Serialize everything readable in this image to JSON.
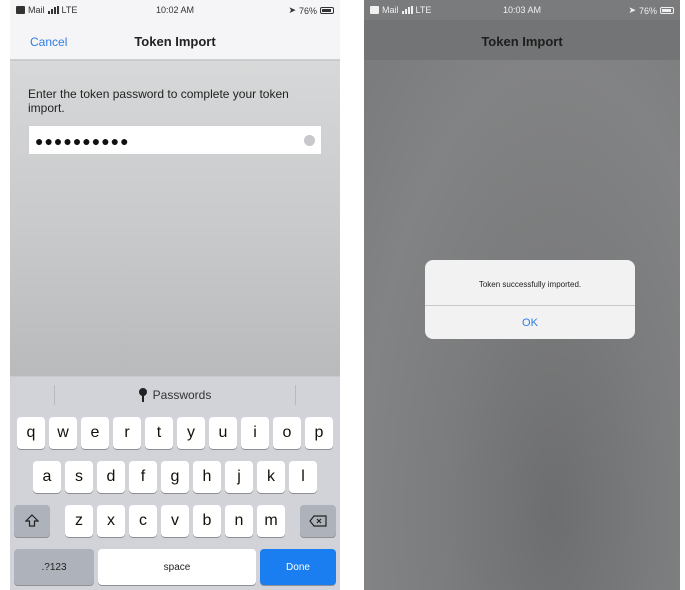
{
  "left": {
    "status": {
      "carrier": "Mail",
      "network": "LTE",
      "time": "10:02 AM",
      "battery": "76%"
    },
    "nav": {
      "cancel": "Cancel",
      "title": "Token Import"
    },
    "prompt": "Enter the token password to complete your token import.",
    "password_value": "●●●●●●●●●●",
    "keyboard": {
      "suggestion": "Passwords",
      "row1": [
        "q",
        "w",
        "e",
        "r",
        "t",
        "y",
        "u",
        "i",
        "o",
        "p"
      ],
      "row2": [
        "a",
        "s",
        "d",
        "f",
        "g",
        "h",
        "j",
        "k",
        "l"
      ],
      "row3": [
        "z",
        "x",
        "c",
        "v",
        "b",
        "n",
        "m"
      ],
      "numbers_key": ".?123",
      "space_key": "space",
      "done_key": "Done"
    }
  },
  "right": {
    "status": {
      "carrier": "Mail",
      "network": "LTE",
      "time": "10:03 AM",
      "battery": "76%"
    },
    "nav": {
      "title": "Token Import"
    },
    "alert": {
      "message": "Token successfully imported.",
      "ok": "OK"
    }
  }
}
